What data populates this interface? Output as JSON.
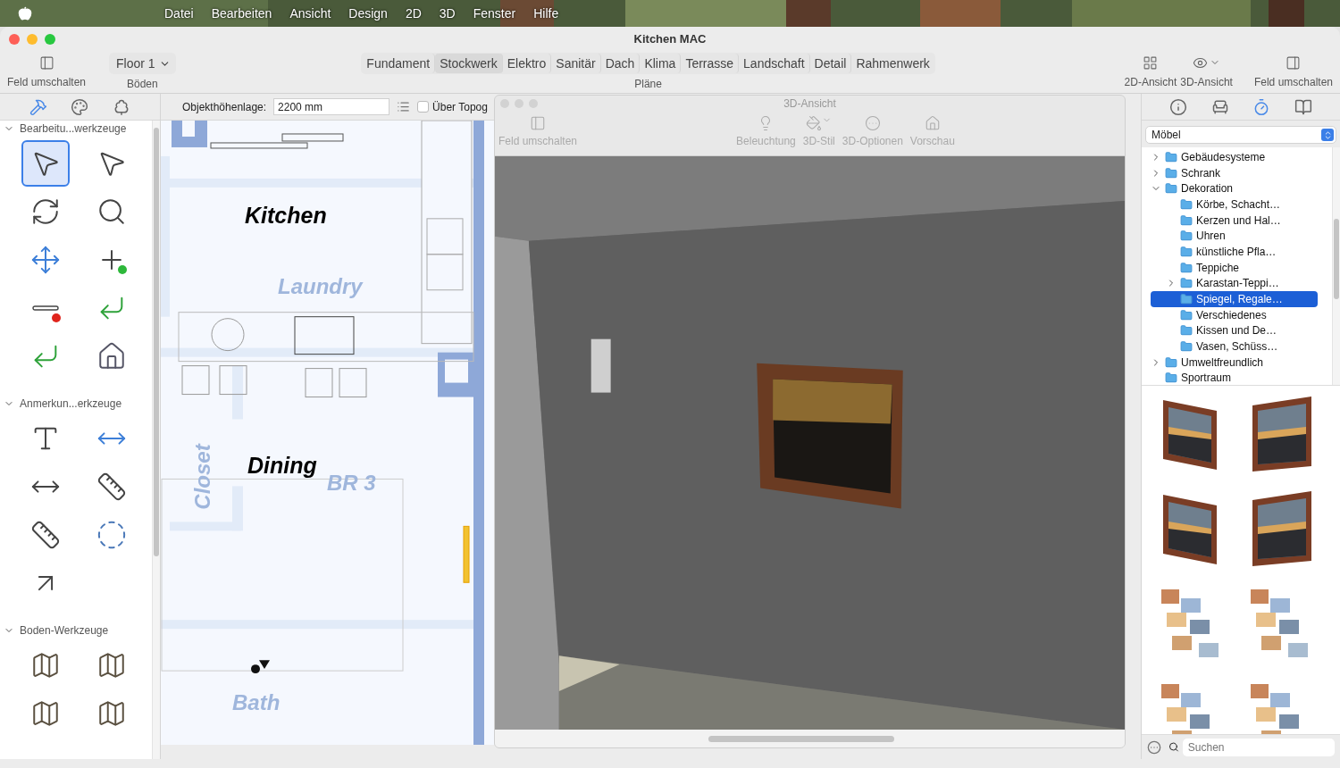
{
  "menu_bar": {
    "items": [
      "Datei",
      "Bearbeiten",
      "Ansicht",
      "Design",
      "2D",
      "3D",
      "Fenster",
      "Hilfe"
    ]
  },
  "window": {
    "title": "Kitchen MAC"
  },
  "toolbar": {
    "left_toggle": {
      "label": "Feld umschalten"
    },
    "floors": {
      "value": "Floor 1",
      "label": "Böden"
    },
    "plans": {
      "label": "Pläne",
      "segments": [
        {
          "label": "Fundament",
          "selected": false
        },
        {
          "label": "Stockwerk",
          "selected": true
        },
        {
          "label": "Elektro",
          "selected": false
        },
        {
          "label": "Sanitär",
          "selected": false
        },
        {
          "label": "Dach",
          "selected": false
        },
        {
          "label": "Klima",
          "selected": false
        },
        {
          "label": "Terrasse",
          "selected": false
        },
        {
          "label": "Landschaft",
          "selected": false
        },
        {
          "label": "Detail",
          "selected": false
        },
        {
          "label": "Rahmenwerk",
          "selected": false
        }
      ]
    },
    "right_buttons": [
      {
        "kind": "plan",
        "label": "2D-Ansicht"
      },
      {
        "kind": "eye",
        "label": "3D-Ansicht"
      },
      {
        "kind": "toggle",
        "label": "Feld umschalten"
      }
    ]
  },
  "left_tabs": [
    {
      "kind": "hammer",
      "selected": true
    },
    {
      "kind": "palette",
      "selected": false
    },
    {
      "kind": "tree",
      "selected": false
    }
  ],
  "options_bar": {
    "elevation_label": "Objekthöhenlage:",
    "elevation_value": "2200 mm",
    "topo_checkbox": {
      "label": "Über Topog",
      "checked": false
    }
  },
  "tool_sections": [
    {
      "title": "Bearbeitu...werkzeuge",
      "expanded": true,
      "tools": [
        {
          "kind": "select",
          "selected": true
        },
        {
          "kind": "select-edit",
          "selected": false
        },
        {
          "kind": "rotate",
          "selected": false
        },
        {
          "kind": "zoom",
          "selected": false
        },
        {
          "kind": "pan",
          "selected": false
        },
        {
          "kind": "add-point",
          "selected": false
        },
        {
          "kind": "delete-point",
          "selected": false
        },
        {
          "kind": "fillet",
          "selected": false
        },
        {
          "kind": "chamfer",
          "selected": false
        },
        {
          "kind": "house",
          "selected": false
        }
      ]
    },
    {
      "title": "Anmerkun...erkzeuge",
      "expanded": true,
      "tools": [
        {
          "kind": "text",
          "selected": false
        },
        {
          "kind": "dimension",
          "selected": false
        },
        {
          "kind": "dim-line",
          "selected": false
        },
        {
          "kind": "ruler",
          "selected": false
        },
        {
          "kind": "ruler",
          "selected": false
        },
        {
          "kind": "radial",
          "selected": false
        },
        {
          "kind": "arrow",
          "selected": false
        }
      ]
    },
    {
      "title": "Boden-Werkzeuge",
      "expanded": true,
      "tools": [
        {
          "kind": "floor",
          "selected": false
        },
        {
          "kind": "floor",
          "selected": false
        },
        {
          "kind": "floor",
          "selected": false
        },
        {
          "kind": "floor",
          "selected": false
        }
      ]
    }
  ],
  "plan": {
    "room_labels": [
      {
        "text": "Kitchen",
        "kind": "active"
      },
      {
        "text": "Laundry",
        "kind": "faint"
      },
      {
        "text": "Closet",
        "kind": "faint-vertical"
      },
      {
        "text": "Dining",
        "kind": "active"
      },
      {
        "text": "BR 3",
        "kind": "faint"
      },
      {
        "text": "Bath",
        "kind": "faint"
      }
    ]
  },
  "view_3d": {
    "title": "3D-Ansicht",
    "toolbar": [
      {
        "kind": "toggle",
        "label": "Feld umschalten"
      },
      {
        "kind": "bulb",
        "label": "Beleuchtung"
      },
      {
        "kind": "style",
        "label": "3D-Stil"
      },
      {
        "kind": "options",
        "label": "3D-Optionen"
      },
      {
        "kind": "house",
        "label": "Vorschau"
      }
    ]
  },
  "library": {
    "tabs": [
      {
        "kind": "info",
        "selected": false
      },
      {
        "kind": "chair",
        "selected": false
      },
      {
        "kind": "timer",
        "selected": true
      },
      {
        "kind": "book",
        "selected": false
      }
    ],
    "category": "Möbel",
    "tree": [
      {
        "kind": "group",
        "label": "Gebäudesysteme",
        "expanded": false,
        "selected": false
      },
      {
        "kind": "group",
        "label": "Schrank",
        "expanded": false,
        "selected": false
      },
      {
        "kind": "group",
        "label": "Dekoration",
        "expanded": true,
        "selected": false,
        "children": [
          {
            "kind": "leaf",
            "label": "Körbe, Schacht…",
            "selected": false
          },
          {
            "kind": "leaf",
            "label": "Kerzen und Hal…",
            "selected": false
          },
          {
            "kind": "leaf",
            "label": "Uhren",
            "selected": false
          },
          {
            "kind": "leaf",
            "label": "künstliche Pfla…",
            "selected": false
          },
          {
            "kind": "leaf",
            "label": "Teppiche",
            "selected": false
          },
          {
            "kind": "group",
            "label": "Karastan-Teppi…",
            "expanded": false,
            "selected": false
          },
          {
            "kind": "leaf",
            "label": "Spiegel, Regale…",
            "selected": true
          },
          {
            "kind": "leaf",
            "label": "Verschiedenes",
            "selected": false
          },
          {
            "kind": "leaf",
            "label": "Kissen und De…",
            "selected": false
          },
          {
            "kind": "leaf",
            "label": "Vasen, Schüss…",
            "selected": false
          }
        ]
      },
      {
        "kind": "group",
        "label": "Umweltfreundlich",
        "expanded": false,
        "selected": false
      },
      {
        "kind": "leaf",
        "label": "Sportraum",
        "selected": false
      }
    ],
    "search": {
      "placeholder": "Suchen"
    }
  }
}
